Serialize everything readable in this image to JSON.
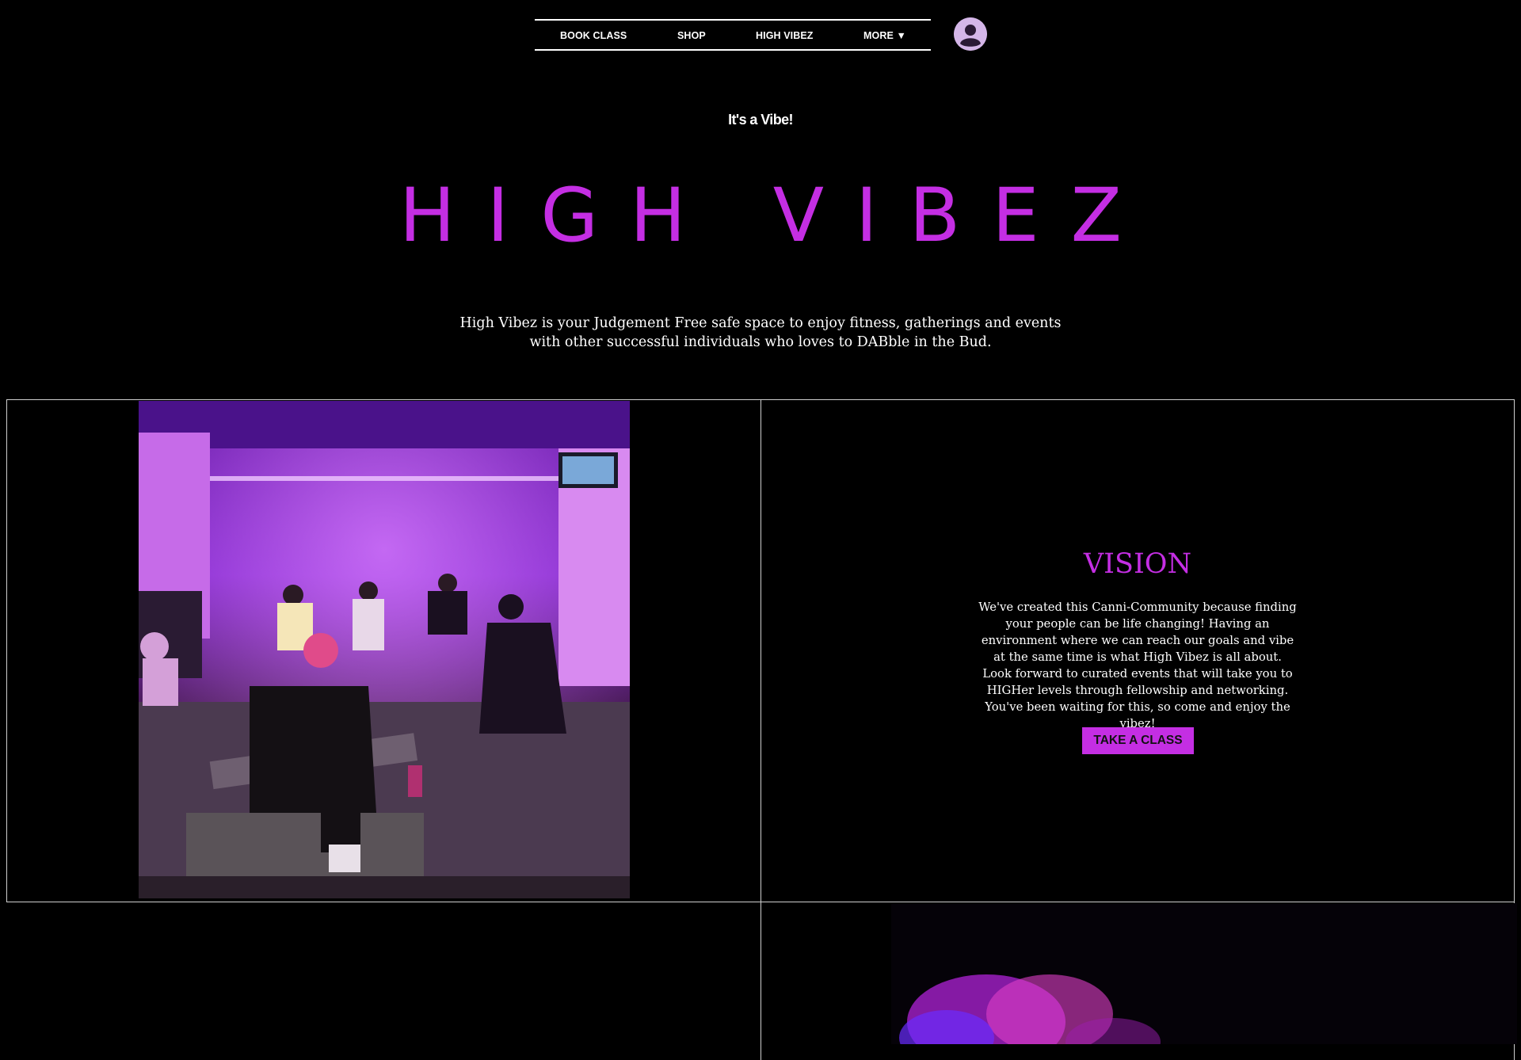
{
  "nav": {
    "items": [
      {
        "label": "BOOK CLASS"
      },
      {
        "label": "SHOP"
      },
      {
        "label": "HIGH VIBEZ"
      },
      {
        "label": "MORE ▼"
      }
    ]
  },
  "hero": {
    "tagline": "It's a Vibe!",
    "title": "HIGH VIBEZ",
    "intro": "High Vibez is your Judgement Free safe space to enjoy fitness, gatherings and events with other successful individuals who loves to DABble in the Bud."
  },
  "vision": {
    "title": "VISION",
    "text": "We've created this Canni-Community because finding your people can be life changing! Having an environment where we can reach our goals and vibe at the same time is what High Vibez is all about. Look forward to curated events that will take you to HIGHer levels through fellowship and networking. You've been waiting for this, so come and enjoy the vibez!",
    "cta_label": "TAKE A CLASS"
  },
  "colors": {
    "accent": "#c42ee3",
    "background": "#000000",
    "text": "#ffffff"
  },
  "icons": {
    "avatar": "user-avatar-icon"
  }
}
